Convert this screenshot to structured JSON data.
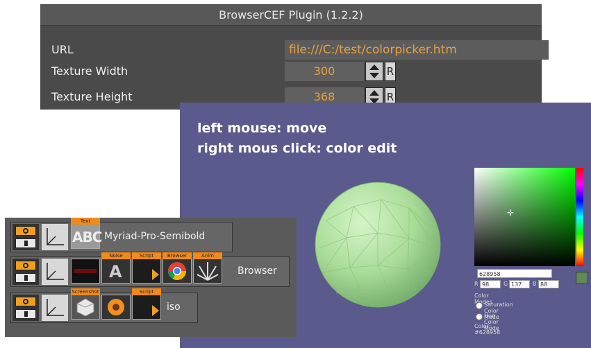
{
  "plugin": {
    "title": "BrowserCEF Plugin (1.2.2)",
    "url_label": "URL",
    "url_value": "file:///C:/test/colorpicker.htm",
    "width_label": "Texture Width",
    "width_value": "300",
    "height_label": "Texture Height",
    "height_value": "368",
    "reset_label": "R"
  },
  "browser": {
    "line1": "left mouse: move",
    "line2": "right mous click: color edit",
    "sphere_color": "#a8dc98"
  },
  "picker": {
    "hex": "628958",
    "r": "98",
    "g": "137",
    "b": "88",
    "r_label": "R",
    "g_label": "G",
    "b_label": "B",
    "modes_title": "Color Modes",
    "mode1": "Saturation Color Mode",
    "mode2": "Hue Color Mode",
    "color_readout": "Color: #628958"
  },
  "nodes": {
    "row1_label": "Myriad-Pro-Semibold",
    "row2_label": "Browser",
    "row3_label": "iso",
    "tag_text": "Text",
    "tag_noise": "Noise",
    "tag_script": "Script",
    "tag_browser": "Browser",
    "tag_anim": "Anim",
    "tag_screenshot": "Screenshot",
    "abc_text": "ABC"
  }
}
